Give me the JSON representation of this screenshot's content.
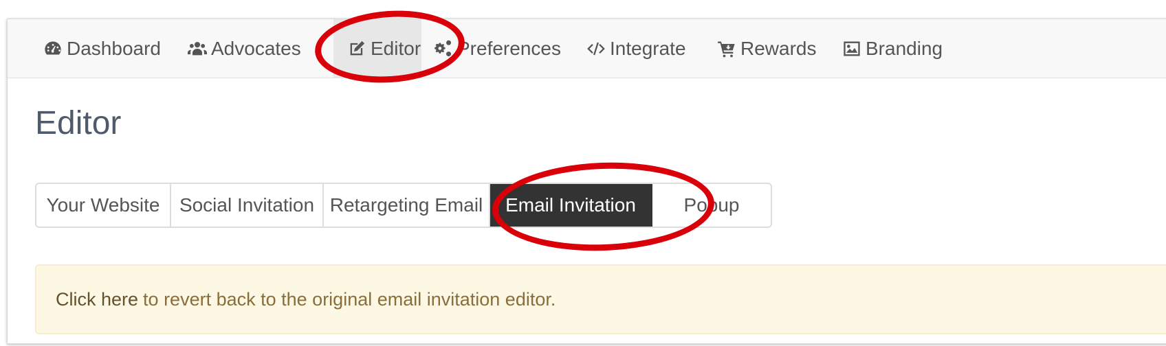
{
  "nav": {
    "items": [
      {
        "label": "Dashboard",
        "icon": "dashboard-icon"
      },
      {
        "label": "Advocates",
        "icon": "users-icon"
      },
      {
        "label": "Editor",
        "icon": "edit-icon"
      },
      {
        "label": "Preferences",
        "icon": "gears-icon"
      },
      {
        "label": "Integrate",
        "icon": "code-icon"
      },
      {
        "label": "Rewards",
        "icon": "cart-icon"
      },
      {
        "label": "Branding",
        "icon": "image-icon"
      }
    ],
    "active": "Editor"
  },
  "page": {
    "title": "Editor"
  },
  "subtabs": {
    "items": [
      "Your Website",
      "Social Invitation",
      "Retargeting Email",
      "Email Invitation",
      "Popup"
    ],
    "active": "Email Invitation"
  },
  "alert": {
    "link_text": "Click here",
    "text": "to revert back to the original email invitation editor."
  },
  "colors": {
    "annotation_ring": "#d9000a",
    "active_subtab_bg": "#333333",
    "alert_bg": "#fcf8e3",
    "alert_text": "#8a6d3b"
  }
}
